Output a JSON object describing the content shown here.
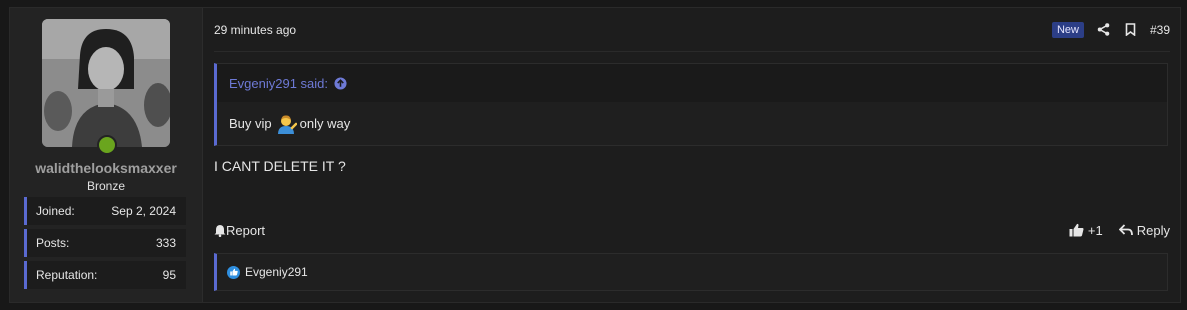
{
  "user": {
    "username": "walidthelooksmaxxer",
    "title": "Bronze",
    "stats": [
      {
        "label": "Joined:",
        "value": "Sep 2, 2024"
      },
      {
        "label": "Posts:",
        "value": "333"
      },
      {
        "label": "Reputation:",
        "value": "95"
      }
    ]
  },
  "post": {
    "time": "29 minutes ago",
    "badge": "New",
    "number": "#39",
    "quote": {
      "author_said": "Evgeniy291 said:",
      "text_before": "Buy vip",
      "text_after": "only way"
    },
    "message": "I CANT DELETE IT ?",
    "report_label": "Report",
    "like_count": "+1",
    "reply_label": "Reply",
    "reactions_user": "Evgeniy291"
  },
  "colors": {
    "accent": "#5a6ad1",
    "online": "#6aa51e",
    "badge_bg": "#2c3e86",
    "like": "#2f8fe0"
  },
  "icons": [
    "share-icon",
    "bookmark-icon",
    "arrow-up-circle-icon",
    "bell-icon",
    "thumbs-up-icon",
    "reply-icon"
  ]
}
